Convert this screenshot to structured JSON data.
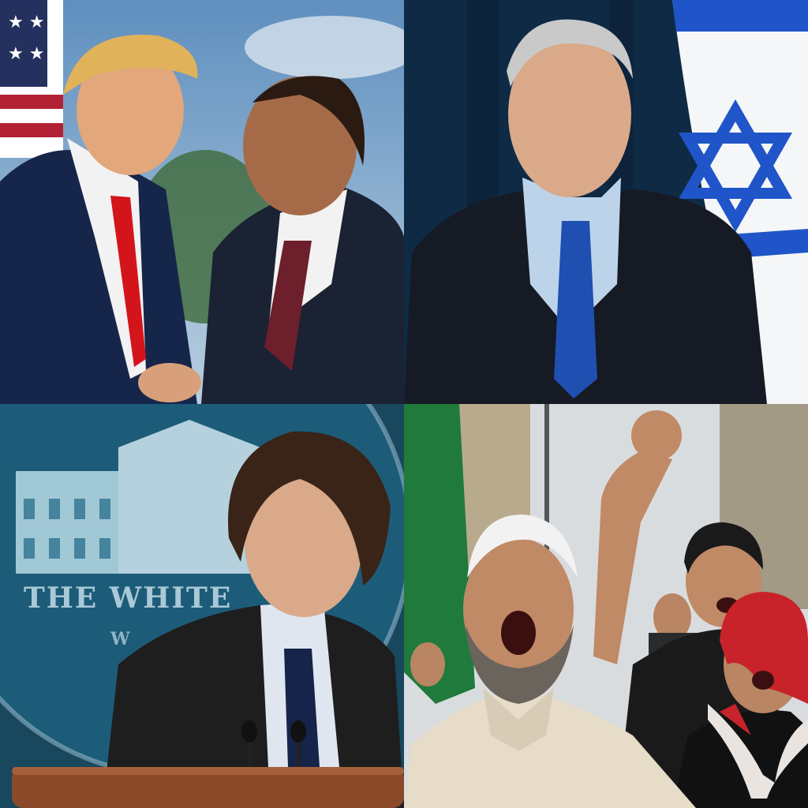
{
  "panels": {
    "top_left": {
      "colors": {
        "sky": "#7fa6c9",
        "suit_left": "#16264a",
        "suit_right": "#1b2233",
        "tie_left": "#d4141b",
        "tie_right": "#6e1f2c",
        "flag_red": "#b22234"
      }
    },
    "top_right": {
      "colors": {
        "curtain": "#0f2a44",
        "suit": "#151a24",
        "shirt": "#bcd3ea",
        "tie": "#1f4fb0",
        "flag_blue": "#1f55c8"
      }
    },
    "bottom_left": {
      "seal_text_line1": "THE WHITE",
      "seal_text_line2": "W",
      "colors": {
        "backdrop": "#1d5c78",
        "jacket": "#1e1e1e",
        "tie": "#16234a",
        "podium": "#8a4a2a"
      }
    },
    "bottom_right": {
      "colors": {
        "sky": "#d9dcdf",
        "banner": "#1f7a3c",
        "robe": "#e6dcc8",
        "keffiyeh": "#c8232b"
      }
    }
  }
}
